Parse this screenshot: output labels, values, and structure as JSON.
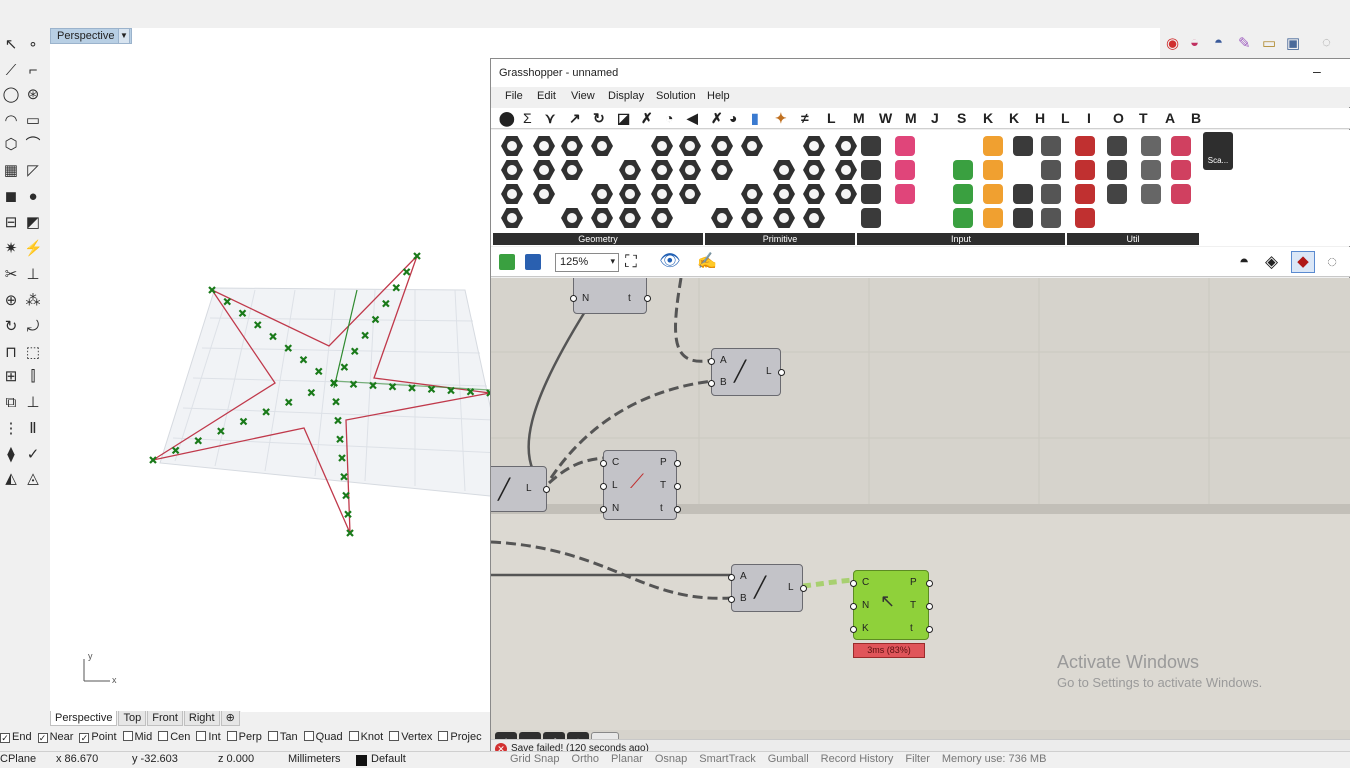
{
  "rhino": {
    "viewport_title": "Perspective",
    "viewport_tabs": [
      "Perspective",
      "Top",
      "Front",
      "Right"
    ],
    "osnaps": [
      {
        "label": "End",
        "checked": true
      },
      {
        "label": "Near",
        "checked": true
      },
      {
        "label": "Point",
        "checked": true
      },
      {
        "label": "Mid",
        "checked": false
      },
      {
        "label": "Cen",
        "checked": false
      },
      {
        "label": "Int",
        "checked": false
      },
      {
        "label": "Perp",
        "checked": false
      },
      {
        "label": "Tan",
        "checked": false
      },
      {
        "label": "Quad",
        "checked": false
      },
      {
        "label": "Knot",
        "checked": false
      },
      {
        "label": "Vertex",
        "checked": false
      },
      {
        "label": "Projec",
        "checked": false
      }
    ],
    "status": {
      "cplane": "CPlane",
      "x": "x 86.670",
      "y": "y -32.603",
      "z": "z 0.000",
      "units": "Millimeters",
      "layer": "Default",
      "toggles": [
        "Grid Snap",
        "Ortho",
        "Planar",
        "Osnap",
        "SmartTrack",
        "Gumball",
        "Record History",
        "Filter"
      ],
      "memory": "Memory use: 736 MB"
    },
    "axis_x": "x",
    "axis_y": "y"
  },
  "grasshopper": {
    "title": "Grasshopper - unnamed",
    "minimize": "–",
    "menus": [
      "File",
      "Edit",
      "View",
      "Display",
      "Solution",
      "Help"
    ],
    "categories_letters": [
      "L",
      "M",
      "W",
      "M",
      "J",
      "S",
      "K",
      "K",
      "H",
      "L",
      "I",
      "O",
      "T",
      "A",
      "B"
    ],
    "panels": [
      "Geometry",
      "Primitive",
      "Input",
      "Util"
    ],
    "zoom": "125%",
    "node_labels": {
      "n1": {
        "in": [
          "N"
        ],
        "out": [
          "t"
        ]
      },
      "line1": {
        "in": [
          "A",
          "B"
        ],
        "out": [
          "L"
        ]
      },
      "line_left": {
        "out": [
          "L"
        ]
      },
      "seg": {
        "in": [
          "C",
          "L",
          "N"
        ],
        "out": [
          "P",
          "T",
          "t"
        ]
      },
      "line2": {
        "in": [
          "A",
          "B"
        ],
        "out": [
          "L"
        ]
      },
      "green": {
        "in": [
          "C",
          "N",
          "K"
        ],
        "out": [
          "P",
          "T",
          "t"
        ],
        "badge": "3ms (83%)"
      }
    },
    "status_message": "Save failed! (120 seconds ago)",
    "truncated_label": "Sca..."
  },
  "activate": {
    "title": "Activate Windows",
    "subtitle": "Go to Settings to activate Windows."
  }
}
